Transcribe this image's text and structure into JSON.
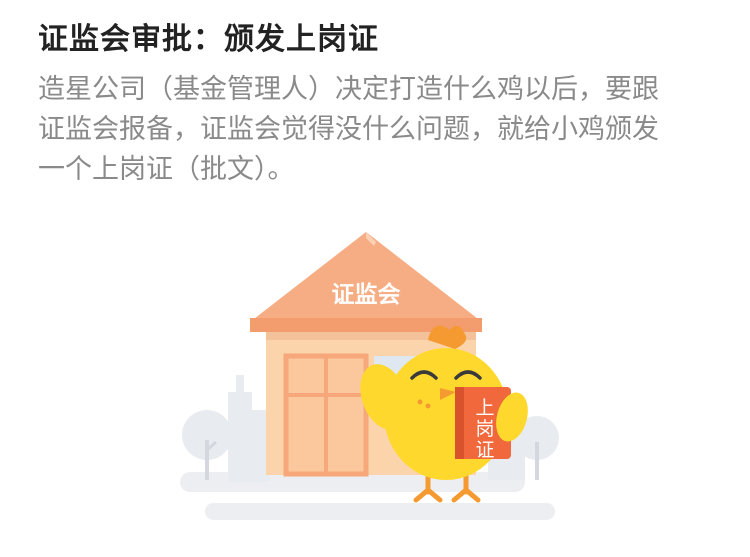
{
  "article": {
    "heading": "证监会审批：颁发上岗证",
    "paragraph_lines": [
      "造星公司（基金管理人）决定打造什么鸡以后，要跟",
      "证监会报备，证监会觉得没什么问题，就给小鸡颁发",
      "一个上岗证（批文）。"
    ]
  },
  "illustration": {
    "roof_sign": "证监会",
    "certificate_text": "上岗证",
    "colors": {
      "roof": "#f7ad84",
      "wall": "#fbd4ab",
      "door": "#f6a87a",
      "chick": "#ffd82e",
      "crest": "#f59a30",
      "certificate": "#f0683c",
      "ground": "#e9ebee"
    }
  }
}
